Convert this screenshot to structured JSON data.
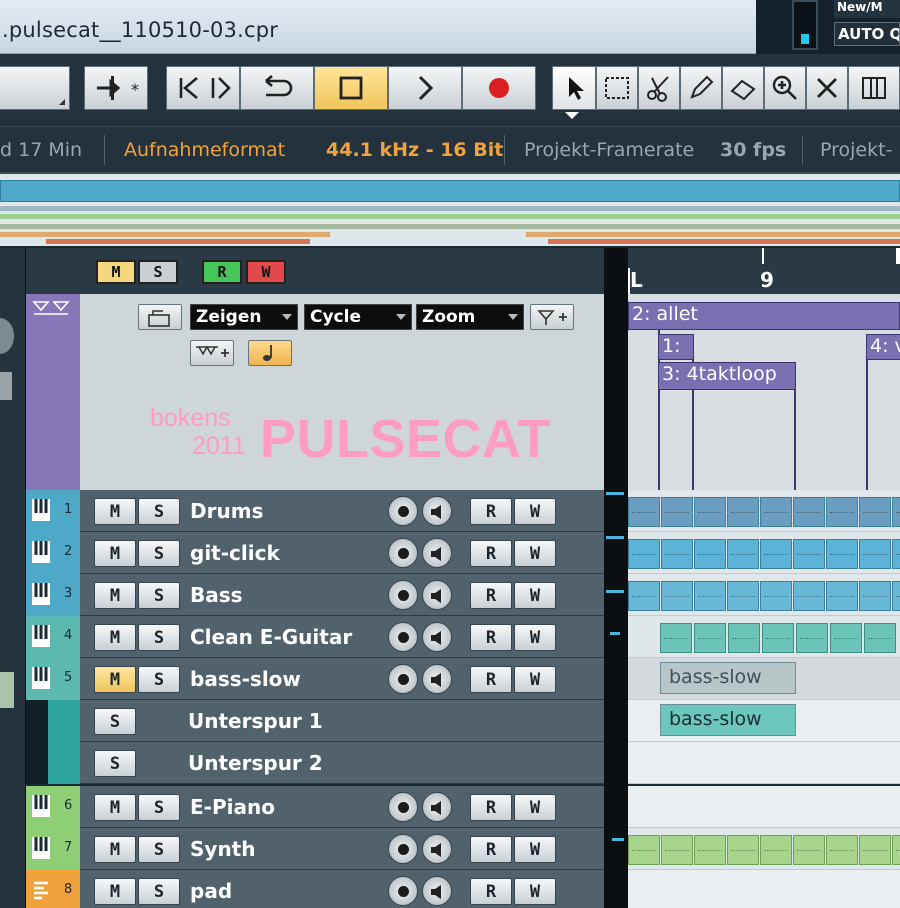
{
  "window": {
    "title": ".pulsecat__110510-03.cpr",
    "top_right_label": "New/M",
    "autoq_label": "AUTO Q"
  },
  "colors": {
    "accent_orange": "#f0a33c",
    "track_cyan": "#4ea8c8",
    "track_green": "#8ecf75",
    "marker_purple": "#7a6fb0",
    "logo_pink": "#ff9cc4"
  },
  "toolbar": {
    "icons": [
      "transport-go-start-icon",
      "transport-go-end-icon",
      "cycle-icon",
      "stop-icon",
      "play-icon",
      "record-icon",
      "object-select-icon",
      "range-select-icon",
      "split-icon",
      "draw-icon",
      "erase-icon",
      "zoom-icon",
      "mute-icon",
      "time-warp-icon"
    ]
  },
  "info": {
    "duration": "d 17 Min",
    "record_format_label": "Aufnahmeformat",
    "record_format_value": "44.1 kHz - 16 Bit",
    "framerate_label": "Projekt-Framerate",
    "framerate_value": "30 fps",
    "project_label": "Projekt-"
  },
  "track_header": {
    "flags": [
      {
        "label": "M",
        "color": "#f5d77d"
      },
      {
        "label": "S",
        "color": "#c6cfd4"
      },
      {
        "label": "R",
        "color": "#45c65a"
      },
      {
        "label": "W",
        "color": "#e24a4a"
      }
    ],
    "dropdowns": {
      "show": "Zeigen",
      "cycle": "Cycle",
      "zoom": "Zoom"
    }
  },
  "logo": {
    "line1": "bokens",
    "line2": "2011",
    "brand": "PULSECAT"
  },
  "tracks": [
    {
      "num": "1",
      "name": "Drums",
      "color": "#4ea8c8",
      "mute_on": false
    },
    {
      "num": "2",
      "name": "git-click",
      "color": "#4ea8c8",
      "mute_on": false
    },
    {
      "num": "3",
      "name": "Bass",
      "color": "#4ea8c8",
      "mute_on": false
    },
    {
      "num": "4",
      "name": "Clean E-Guitar",
      "color": "#5db8b0",
      "mute_on": false
    },
    {
      "num": "5",
      "name": "bass-slow",
      "color": "#5db8b0",
      "mute_on": true
    },
    {
      "num": "6",
      "name": "E-Piano",
      "color": "#8ecf75",
      "mute_on": false
    },
    {
      "num": "7",
      "name": "Synth",
      "color": "#8ecf75",
      "mute_on": false
    },
    {
      "num": "8",
      "name": "pad",
      "color": "#f0a33c",
      "mute_on": false
    }
  ],
  "subtracks": [
    {
      "name": "Unterspur 1"
    },
    {
      "name": "Unterspur 2"
    }
  ],
  "buttons": {
    "mute": "M",
    "solo": "S",
    "read": "R",
    "write": "W"
  },
  "ruler": {
    "left_label": "L",
    "bar_label": "9"
  },
  "markers": {
    "allet": "2: allet",
    "m1": "1:",
    "loop": "3: 4taktloop",
    "m4": "4: v"
  },
  "events": {
    "bass_slow": "bass-slow"
  }
}
